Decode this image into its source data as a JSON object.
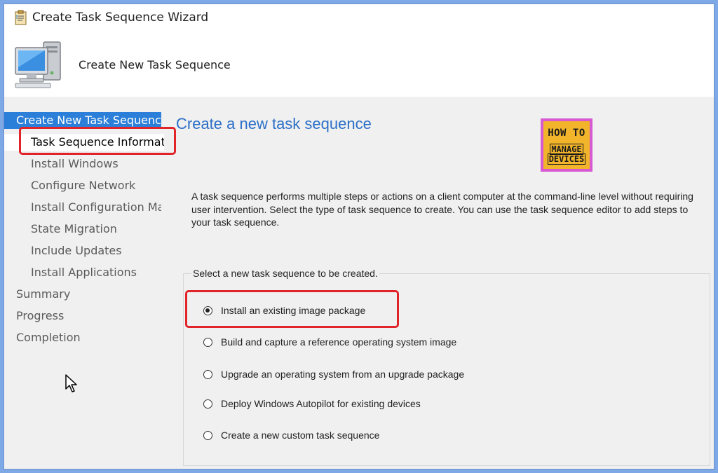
{
  "window": {
    "title": "Create Task Sequence Wizard"
  },
  "header": {
    "title": "Create New Task Sequence"
  },
  "nav": {
    "items": [
      {
        "label": "Create New Task Sequence",
        "level": "top",
        "state": "selected"
      },
      {
        "label": "Task Sequence Information",
        "level": "sub",
        "state": "current"
      },
      {
        "label": "Install Windows",
        "level": "sub",
        "state": ""
      },
      {
        "label": "Configure Network",
        "level": "sub",
        "state": ""
      },
      {
        "label": "Install Configuration Manager",
        "level": "sub",
        "state": ""
      },
      {
        "label": "State Migration",
        "level": "sub",
        "state": ""
      },
      {
        "label": "Include Updates",
        "level": "sub",
        "state": ""
      },
      {
        "label": "Install Applications",
        "level": "sub",
        "state": ""
      },
      {
        "label": "Summary",
        "level": "top",
        "state": ""
      },
      {
        "label": "Progress",
        "level": "top",
        "state": ""
      },
      {
        "label": "Completion",
        "level": "top",
        "state": ""
      }
    ]
  },
  "content": {
    "title": "Create a new task sequence",
    "description": "A task sequence performs multiple steps or actions on a client computer at the command-line level without requiring user intervention. Select the type of task sequence to create. You can use the task sequence editor to add steps to your task sequence.",
    "group_label": "Select a new task sequence to be created.",
    "options": [
      {
        "label": "Install an existing image package",
        "checked": true
      },
      {
        "label": "Build and capture a reference operating system image",
        "checked": false
      },
      {
        "label": "Upgrade an operating system from an upgrade package",
        "checked": false
      },
      {
        "label": "Deploy Windows Autopilot for existing devices",
        "checked": false
      },
      {
        "label": "Create a new custom task sequence",
        "checked": false
      }
    ]
  },
  "logo": {
    "line1": "HOW TO",
    "line2a": "MANAGE",
    "line2b": "DEVICES"
  },
  "colors": {
    "accent": "#2b7fd8",
    "title_blue": "#2b6fc7",
    "highlight": "#e0242a",
    "logo_pink": "#d85ad3",
    "logo_orange": "#f1b42a"
  }
}
